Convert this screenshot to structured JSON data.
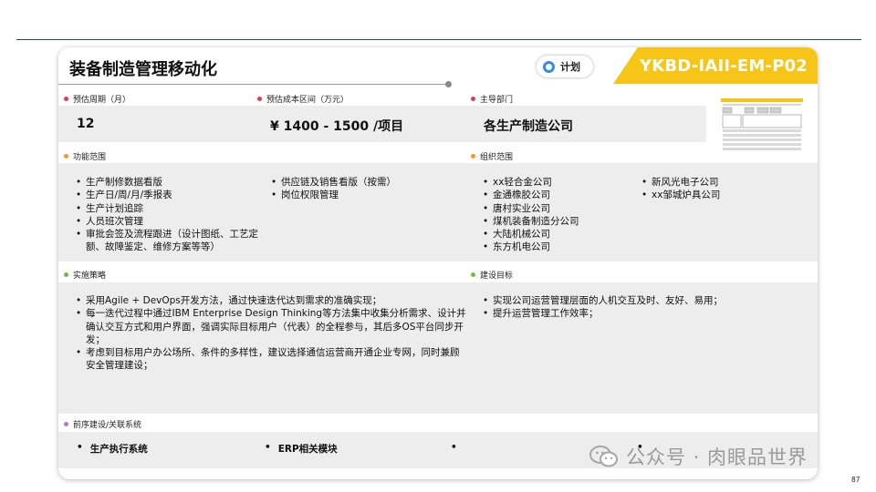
{
  "header": {
    "title": "装备制造管理移动化",
    "plan_label": "计划",
    "code": "YKBD-IAII-EM-P02"
  },
  "colors": {
    "accent_yellow": "#f6c518",
    "plan_blue": "#2f8fe0",
    "dot_red": "#e03c4a",
    "dot_orange": "#f09a1f",
    "dot_green": "#6fbe3c",
    "dot_purple": "#b07ad6",
    "band_gray": "#ededed"
  },
  "summary": {
    "period_label": "预估周期（月）",
    "period_value": "12",
    "cost_label": "预估成本区间（万元）",
    "cost_value": "¥ 1400 - 1500 /项目",
    "dept_label": "主导部门",
    "dept_value": "各生产制造公司"
  },
  "function_scope": {
    "label": "功能范围",
    "col1": [
      "生产制修数据看版",
      "生产日/周/月/季报表",
      "生产计划追踪",
      "人员班次管理",
      "审批会签及流程跟进（设计图纸、工艺定额、故障鉴定、维修方案等等）"
    ],
    "col2": [
      "供应链及销售看版（按需）",
      "岗位权限管理"
    ]
  },
  "org_scope": {
    "label": "组织范围",
    "col1": [
      "xx轻合金公司",
      "金通橡胶公司",
      "唐村实业公司",
      "煤机装备制造分公司",
      "大陆机械公司",
      "东方机电公司"
    ],
    "col2": [
      "新风光电子公司",
      "xx邹城炉具公司"
    ]
  },
  "strategy": {
    "label": "实施策略",
    "items": [
      "采用Agile + DevOps开发方法，通过快速迭代达到需求的准确实现；",
      "每一迭代过程中通过IBM Enterprise Design Thinking等方法集中收集分析需求、设计并确认交互方式和用户界面，强调实际目标用户（代表）的全程参与，其后多OS平台同步开发；",
      "考虑到目标用户办公场所、条件的多样性，建议选择通信运营商开通企业专网，同时兼顾安全管理建设；"
    ]
  },
  "goals": {
    "label": "建设目标",
    "items": [
      "实现公司运营管理层面的人机交互及时、友好、易用；",
      "提升运营管理工作效率；"
    ]
  },
  "prerequisites": {
    "label": "前序建设/关联系统",
    "items": [
      "生产执行系统",
      "ERP相关模块",
      "",
      ""
    ]
  },
  "footer": {
    "watermark": "公众号 · 肉眼品世界",
    "page_number": "87"
  }
}
